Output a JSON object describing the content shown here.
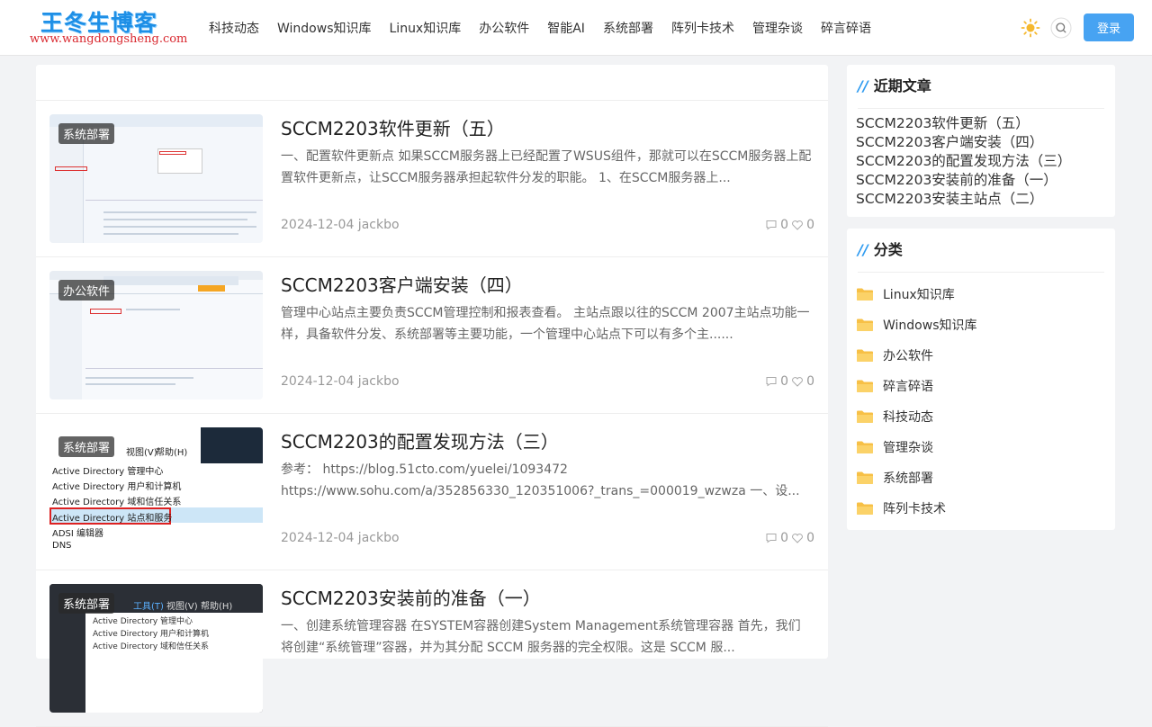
{
  "header": {
    "logo_main": "王冬生博客",
    "logo_sub": "www.wangdongsheng.com",
    "nav": [
      "科技动态",
      "Windows知识库",
      "Linux知识库",
      "办公软件",
      "智能AI",
      "系统部署",
      "阵列卡技术",
      "管理杂谈",
      "碎言碎语"
    ],
    "login_label": "登录",
    "icons": [
      "sun-icon",
      "search-icon"
    ]
  },
  "posts": [
    {
      "badge": "系统部署",
      "title": "SCCM2203软件更新（五）",
      "excerpt": "一、配置软件更新点 如果SCCM服务器上已经配置了WSUS组件，那就可以在SCCM服务器上配置软件更新点，让SCCM服务器承担起软件分发的职能。 1、在SCCM服务器上...",
      "meta": "2024-12-04 jackbo",
      "comments": "0",
      "likes": "0"
    },
    {
      "badge": "办公软件",
      "title": "SCCM2203客户端安装（四）",
      "excerpt": "管理中心站点主要负责SCCM管理控制和报表查看。 主站点跟以往的SCCM 2007主站点功能一样，具备软件分发、系统部署等主要功能，一个管理中心站点下可以有多个主......",
      "meta": "2024-12-04 jackbo",
      "comments": "0",
      "likes": "0"
    },
    {
      "badge": "系统部署",
      "title": "SCCM2203的配置发现方法（三）",
      "excerpt": "参考： https://blog.51cto.com/yuelei/1093472 https://www.sohu.com/a/352856330_120351006?_trans_=000019_wzwza 一、设...",
      "meta": "2024-12-04 jackbo",
      "comments": "0",
      "likes": "0",
      "thumb_menu": [
        "视图(V)",
        "帮助(H)",
        "Active Directory 管理中心",
        "Active Directory 用户和计算机",
        "Active Directory 域和信任关系",
        "Active Directory 站点和服务",
        "ADSI 编辑器",
        "DNS"
      ]
    },
    {
      "badge": "系统部署",
      "title": "SCCM2203安装前的准备（一）",
      "excerpt": "一、创建系统管理容器 在SYSTEM容器创建System Management系统管理容器 首先，我们将创建“系统管理”容器，并为其分配 SCCM 服务器的完全权限。这是 SCCM 服...",
      "meta": "2024-12-04 jackbo",
      "comments": "0",
      "likes": "0",
      "thumb_menu": [
        "工具(T)",
        "视图(V)",
        "帮助(H)",
        "Active Directory 管理中心",
        "Active Directory 用户和计算机",
        "Active Directory 域和信任关系"
      ]
    }
  ],
  "sidebar": {
    "recent_title": "近期文章",
    "recent": [
      "SCCM2203软件更新（五）",
      "SCCM2203客户端安装（四）",
      "SCCM2203的配置发现方法（三）",
      "SCCM2203安装前的准备（一）",
      "SCCM2203安装主站点（二）"
    ],
    "cat_title": "分类",
    "categories": [
      "Linux知识库",
      "Windows知识库",
      "办公软件",
      "碎言碎语",
      "科技动态",
      "管理杂谈",
      "系统部署",
      "阵列卡技术"
    ]
  },
  "colors": {
    "accent": "#47a3f2",
    "folder": "#f7c046",
    "title_bar": "#2e9bf0"
  }
}
